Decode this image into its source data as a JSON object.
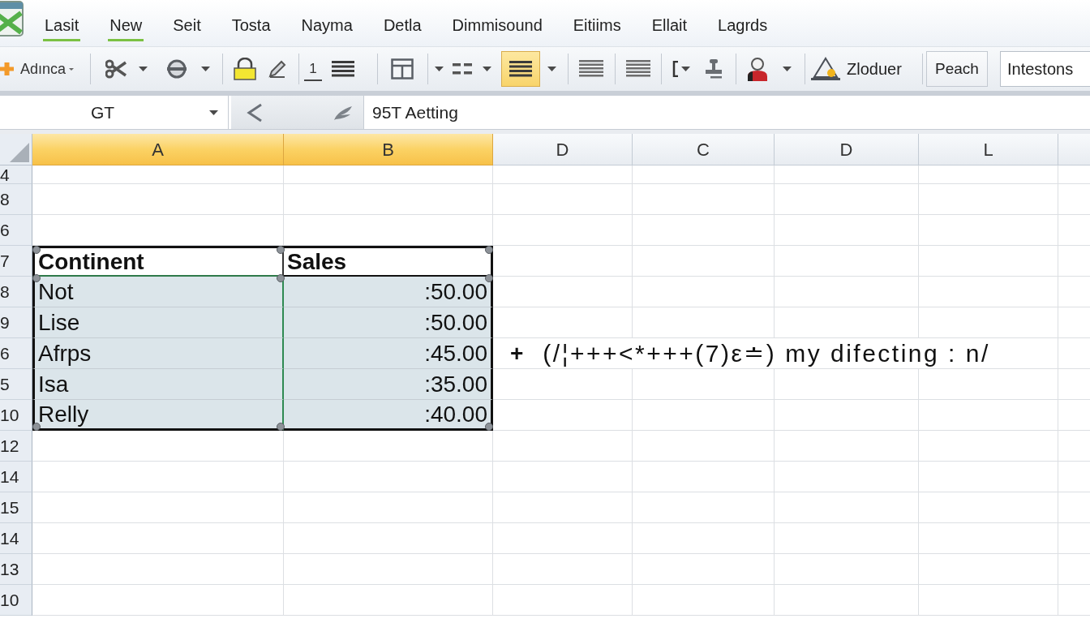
{
  "menu": [
    {
      "label": "Lasit",
      "selected": true
    },
    {
      "label": "New",
      "selected": true
    },
    {
      "label": "Seit",
      "selected": false
    },
    {
      "label": "Tosta",
      "selected": false
    },
    {
      "label": "Nayma",
      "selected": false
    },
    {
      "label": "Detla",
      "selected": false
    },
    {
      "label": "Dimmisound",
      "selected": false
    },
    {
      "label": "Eitiims",
      "selected": false
    },
    {
      "label": "Ellait",
      "selected": false
    },
    {
      "label": "Lagrds",
      "selected": false
    }
  ],
  "toolbar": {
    "add_button": {
      "label": "Adınca"
    },
    "numbered_button": {
      "label": "1"
    },
    "align_button": {
      "selected": true
    },
    "insert_button": {
      "label": "Zloduer"
    },
    "peach_button": {
      "label": "Peach"
    },
    "search_field": {
      "value": "Intestons"
    }
  },
  "formula_bar": {
    "name_box": "GT",
    "formula": "95T Aetting"
  },
  "columns": [
    {
      "label": "A",
      "selected": true
    },
    {
      "label": "B",
      "selected": true
    },
    {
      "label": "D",
      "selected": false
    },
    {
      "label": "C",
      "selected": false
    },
    {
      "label": "D",
      "selected": false
    },
    {
      "label": "L",
      "selected": false
    }
  ],
  "rows": [
    {
      "label": "4",
      "kind": "blank"
    },
    {
      "label": "8",
      "kind": "blank"
    },
    {
      "label": "6",
      "kind": "blank"
    },
    {
      "label": "7",
      "kind": "header",
      "cells": [
        {
          "text": "Continent",
          "selected": false
        },
        {
          "text": "Sales",
          "selected": false
        }
      ]
    },
    {
      "label": "8",
      "kind": "data",
      "cells": [
        {
          "text": "Not",
          "selected": true
        },
        {
          "text": ":50.00",
          "selected": true
        }
      ]
    },
    {
      "label": "9",
      "kind": "data",
      "cells": [
        {
          "text": "Lise",
          "selected": true
        },
        {
          "text": ":50.00",
          "selected": true
        }
      ]
    },
    {
      "label": "6",
      "kind": "data",
      "cells": [
        {
          "text": "Afrps",
          "selected": true
        },
        {
          "text": ":45.00",
          "selected": true
        }
      ],
      "overflow": [
        "+",
        "(/¦+++<*+++(7)ε≐) my difecting : n/"
      ]
    },
    {
      "label": "5",
      "kind": "data",
      "cells": [
        {
          "text": "Isa",
          "selected": true
        },
        {
          "text": ":35.00",
          "selected": true
        }
      ]
    },
    {
      "label": "10",
      "kind": "data",
      "cells": [
        {
          "text": "Relly",
          "selected": true
        },
        {
          "text": ":40.00",
          "selected": true
        }
      ]
    },
    {
      "label": "12",
      "kind": "blank"
    },
    {
      "label": "14",
      "kind": "blank"
    },
    {
      "label": "15",
      "kind": "blank"
    },
    {
      "label": "14",
      "kind": "blank"
    },
    {
      "label": "13",
      "kind": "blank"
    },
    {
      "label": "10",
      "kind": "blank"
    }
  ]
}
